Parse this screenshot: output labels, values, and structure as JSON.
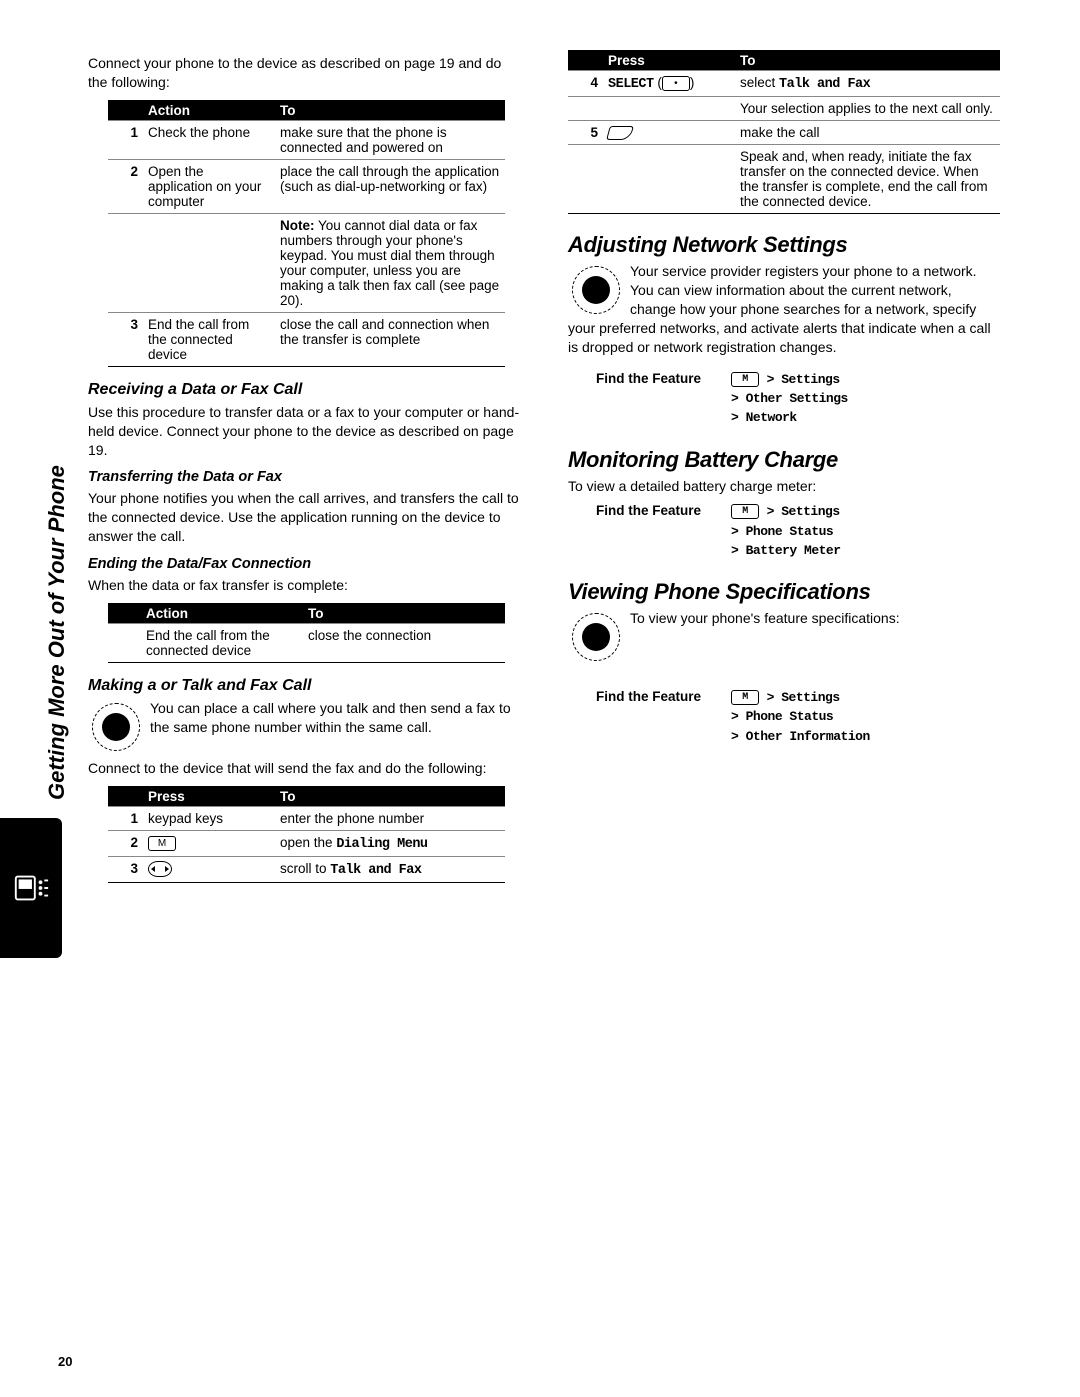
{
  "sidebar": {
    "section_title": "Getting More Out of Your Phone"
  },
  "page_number": "20",
  "left": {
    "intro": "Connect your phone to the device as described on page 19 and do the following:",
    "table1": {
      "head_action": "Action",
      "head_to": "To",
      "rows": [
        {
          "n": "1",
          "action": "Check the phone",
          "to": "make sure that the phone is connected and powered on"
        },
        {
          "n": "2",
          "action": "Open the application on your computer",
          "to": "place the call through the application (such as dial-up-networking or fax)"
        },
        {
          "n": "",
          "action": "",
          "to": "Note: You cannot dial data or fax numbers through your phone's keypad. You must dial them through your computer, unless you are making a talk then fax call (see page 20)."
        },
        {
          "n": "3",
          "action": "End the call from the connected device",
          "to": "close the call and connection when the transfer is complete"
        }
      ]
    },
    "h_receiving": "Receiving a Data or Fax Call",
    "p_receiving": "Use this procedure to transfer data or a fax to your computer or hand-held device. Connect your phone to the device as described on page 19.",
    "h_transfer": "Transferring the Data or Fax",
    "p_transfer": "Your phone notifies you when the call arrives, and transfers the call to the connected device. Use the application running on the device to answer the call.",
    "h_ending": "Ending the Data/Fax Connection",
    "p_ending": "When the data or fax transfer is complete:",
    "table2": {
      "head_action": "Action",
      "head_to": "To",
      "rows": [
        {
          "n": "",
          "action": "End the call from the connected device",
          "to": "close the connection"
        }
      ]
    },
    "h_making": "Making a or Talk and Fax Call",
    "p_making": "You can place a call where you talk and then send a fax to the same phone number within the same call.",
    "p_making2": "Connect to the device that will send the fax and do the following:",
    "table3": {
      "head_press": "Press",
      "head_to": "To",
      "rows": [
        {
          "n": "1",
          "press": "keypad keys",
          "to_plain": "enter the phone number",
          "to_dev": ""
        },
        {
          "n": "2",
          "press_icon": "menu",
          "to_plain": "open the ",
          "to_dev": "Dialing Menu"
        },
        {
          "n": "3",
          "press_icon": "scroll",
          "to_plain": "scroll to ",
          "to_dev": "Talk and Fax"
        }
      ]
    }
  },
  "right": {
    "table4": {
      "head_press": "Press",
      "head_to": "To",
      "rows": [
        {
          "n": "4",
          "press_dev": "SELECT",
          "press_paren_icon": true,
          "to_plain": "select ",
          "to_dev": "Talk and Fax",
          "extra": "Your selection applies to the next call only."
        },
        {
          "n": "5",
          "press_icon": "send",
          "to_plain": "make the call",
          "extra": "Speak and, when ready, initiate the fax transfer on the connected device. When the transfer is complete, end the call from the connected device."
        }
      ]
    },
    "h_network": "Adjusting Network Settings",
    "p_network": "Your service provider registers your phone to a network. You can view information about the current network, change how your phone searches for a network, specify your preferred networks, and activate alerts that indicate when a call is dropped or network registration changes.",
    "find_label": "Find the Feature",
    "path_network": "> Settings\n> Other Settings\n> Network",
    "h_battery": "Monitoring Battery Charge",
    "p_battery": "To view a detailed battery charge meter:",
    "path_battery": "> Settings\n> Phone Status\n> Battery Meter",
    "h_spec": "Viewing Phone Specifications",
    "p_spec": "To view your phone's feature specifications:",
    "path_spec": "> Settings\n> Phone Status\n> Other Information",
    "menu_icon_label": "M"
  }
}
